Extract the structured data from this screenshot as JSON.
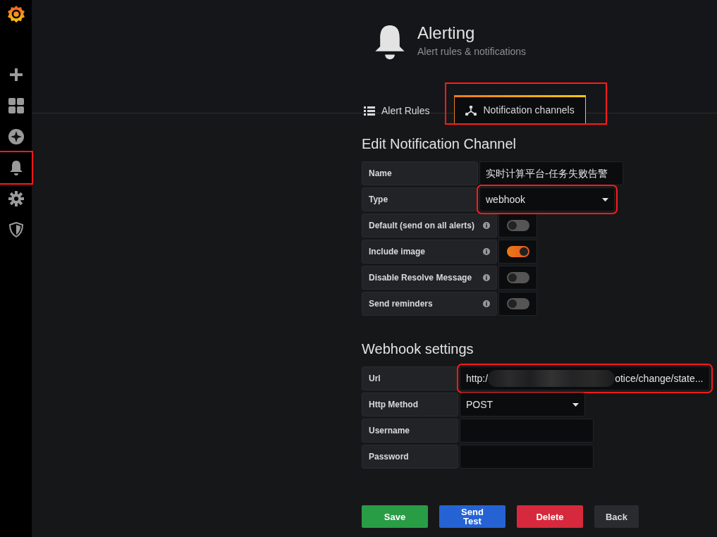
{
  "sidebar": {
    "items": [
      {
        "kind": "plus",
        "highlighted": false
      },
      {
        "kind": "dashboards",
        "highlighted": false
      },
      {
        "kind": "explore",
        "highlighted": false
      },
      {
        "kind": "alerting",
        "highlighted": true
      },
      {
        "kind": "settings",
        "highlighted": false
      },
      {
        "kind": "shield",
        "highlighted": false
      }
    ]
  },
  "header": {
    "title": "Alerting",
    "subtitle": "Alert rules & notifications"
  },
  "tabs": [
    {
      "label": "Alert Rules",
      "kind": "list",
      "selected": false,
      "highlighted": false
    },
    {
      "label": "Notification channels",
      "kind": "channels",
      "selected": true,
      "highlighted": true
    }
  ],
  "edit_section": {
    "title": "Edit Notification Channel",
    "fields": [
      {
        "kind": "text",
        "label": "Name",
        "value": "实时计算平台-任务失败告警",
        "highlighted": false
      },
      {
        "kind": "select",
        "label": "Type",
        "value": "webhook",
        "highlighted": true
      }
    ],
    "switches": [
      {
        "label": "Default (send on all alerts)",
        "on": false
      },
      {
        "label": "Include image",
        "on": true
      },
      {
        "label": "Disable Resolve Message",
        "on": false
      },
      {
        "label": "Send reminders",
        "on": false
      }
    ]
  },
  "webhook_section": {
    "title": "Webhook settings",
    "fields": [
      {
        "kind": "redacted",
        "label": "Url",
        "value_start": "http:/",
        "value_end": "otice/change/state...",
        "highlighted": true
      },
      {
        "kind": "select",
        "label": "Http Method",
        "value": "POST",
        "highlighted": false
      },
      {
        "kind": "text",
        "label": "Username",
        "highlighted": false
      },
      {
        "kind": "text",
        "label": "Password",
        "highlighted": false
      }
    ]
  },
  "buttons": [
    {
      "label": "Save",
      "kind": "success"
    },
    {
      "label": "Send Test",
      "kind": "primary"
    },
    {
      "label": "Delete",
      "kind": "danger"
    },
    {
      "label": "Back",
      "kind": "secondary"
    }
  ]
}
